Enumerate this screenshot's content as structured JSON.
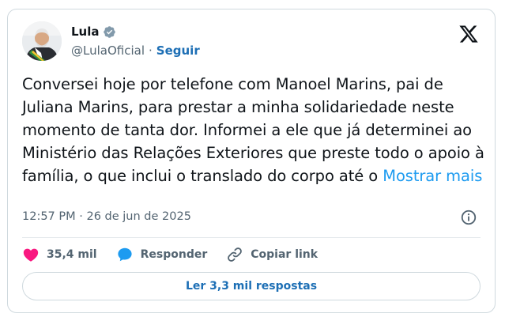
{
  "author": {
    "name": "Lula",
    "handle": "@LulaOficial",
    "separator": "·",
    "follow_label": "Seguir",
    "avatar_icon": "profile-photo",
    "verified_icon": "verified-badge-icon"
  },
  "tweet": {
    "text": "Conversei hoje por telefone com Manoel Marins, pai de Juliana Marins, para prestar a minha solidariedade neste momento de tanta dor. Informei a ele que já determinei ao Ministério das Relações Exteriores que preste todo o apoio à família, o que inclui o translado do corpo até o",
    "show_more_label": "Mostrar mais",
    "timestamp": "12:57 PM · 26 de jun de 2025"
  },
  "actions": {
    "like_count": "35,4 mil",
    "reply_label": "Responder",
    "copy_link_label": "Copiar link"
  },
  "replies_button_label": "Ler 3,3 mil respostas",
  "colors": {
    "like": "#f91880",
    "reply": "#1d9bf0",
    "link_text": "#1d9bf0",
    "follow": "#1d6fb5",
    "muted": "#536471",
    "border": "#cfd9de"
  }
}
